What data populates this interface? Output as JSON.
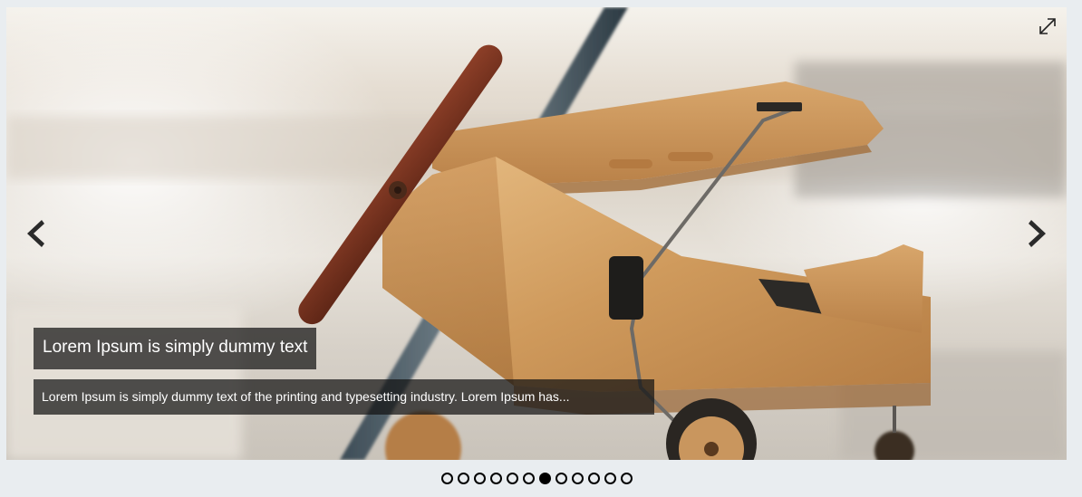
{
  "slider": {
    "caption_title": "Lorem Ipsum is simply dummy text",
    "caption_text": "Lorem Ipsum is simply dummy text of the printing and typesetting industry. Lorem Ipsum has...",
    "image_subject": "wooden toy airplane",
    "prev_icon": "chevron-left-icon",
    "next_icon": "chevron-right-icon",
    "fullscreen_icon": "expand-icon",
    "slide_count": 12,
    "active_slide": 6
  },
  "colors": {
    "page_background": "#e9edf0",
    "caption_background": "rgba(20,20,20,0.72)",
    "caption_text": "#ffffff",
    "dot": "#000000"
  }
}
